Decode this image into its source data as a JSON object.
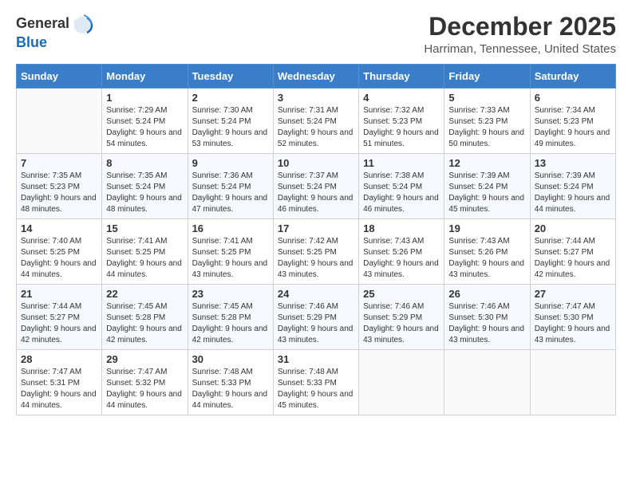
{
  "logo": {
    "general": "General",
    "blue": "Blue"
  },
  "title": "December 2025",
  "location": "Harriman, Tennessee, United States",
  "days_of_week": [
    "Sunday",
    "Monday",
    "Tuesday",
    "Wednesday",
    "Thursday",
    "Friday",
    "Saturday"
  ],
  "weeks": [
    [
      {
        "day": "",
        "sunrise": "",
        "sunset": "",
        "daylight": ""
      },
      {
        "day": "1",
        "sunrise": "Sunrise: 7:29 AM",
        "sunset": "Sunset: 5:24 PM",
        "daylight": "Daylight: 9 hours and 54 minutes."
      },
      {
        "day": "2",
        "sunrise": "Sunrise: 7:30 AM",
        "sunset": "Sunset: 5:24 PM",
        "daylight": "Daylight: 9 hours and 53 minutes."
      },
      {
        "day": "3",
        "sunrise": "Sunrise: 7:31 AM",
        "sunset": "Sunset: 5:24 PM",
        "daylight": "Daylight: 9 hours and 52 minutes."
      },
      {
        "day": "4",
        "sunrise": "Sunrise: 7:32 AM",
        "sunset": "Sunset: 5:23 PM",
        "daylight": "Daylight: 9 hours and 51 minutes."
      },
      {
        "day": "5",
        "sunrise": "Sunrise: 7:33 AM",
        "sunset": "Sunset: 5:23 PM",
        "daylight": "Daylight: 9 hours and 50 minutes."
      },
      {
        "day": "6",
        "sunrise": "Sunrise: 7:34 AM",
        "sunset": "Sunset: 5:23 PM",
        "daylight": "Daylight: 9 hours and 49 minutes."
      }
    ],
    [
      {
        "day": "7",
        "sunrise": "Sunrise: 7:35 AM",
        "sunset": "Sunset: 5:23 PM",
        "daylight": "Daylight: 9 hours and 48 minutes."
      },
      {
        "day": "8",
        "sunrise": "Sunrise: 7:35 AM",
        "sunset": "Sunset: 5:24 PM",
        "daylight": "Daylight: 9 hours and 48 minutes."
      },
      {
        "day": "9",
        "sunrise": "Sunrise: 7:36 AM",
        "sunset": "Sunset: 5:24 PM",
        "daylight": "Daylight: 9 hours and 47 minutes."
      },
      {
        "day": "10",
        "sunrise": "Sunrise: 7:37 AM",
        "sunset": "Sunset: 5:24 PM",
        "daylight": "Daylight: 9 hours and 46 minutes."
      },
      {
        "day": "11",
        "sunrise": "Sunrise: 7:38 AM",
        "sunset": "Sunset: 5:24 PM",
        "daylight": "Daylight: 9 hours and 46 minutes."
      },
      {
        "day": "12",
        "sunrise": "Sunrise: 7:39 AM",
        "sunset": "Sunset: 5:24 PM",
        "daylight": "Daylight: 9 hours and 45 minutes."
      },
      {
        "day": "13",
        "sunrise": "Sunrise: 7:39 AM",
        "sunset": "Sunset: 5:24 PM",
        "daylight": "Daylight: 9 hours and 44 minutes."
      }
    ],
    [
      {
        "day": "14",
        "sunrise": "Sunrise: 7:40 AM",
        "sunset": "Sunset: 5:25 PM",
        "daylight": "Daylight: 9 hours and 44 minutes."
      },
      {
        "day": "15",
        "sunrise": "Sunrise: 7:41 AM",
        "sunset": "Sunset: 5:25 PM",
        "daylight": "Daylight: 9 hours and 44 minutes."
      },
      {
        "day": "16",
        "sunrise": "Sunrise: 7:41 AM",
        "sunset": "Sunset: 5:25 PM",
        "daylight": "Daylight: 9 hours and 43 minutes."
      },
      {
        "day": "17",
        "sunrise": "Sunrise: 7:42 AM",
        "sunset": "Sunset: 5:25 PM",
        "daylight": "Daylight: 9 hours and 43 minutes."
      },
      {
        "day": "18",
        "sunrise": "Sunrise: 7:43 AM",
        "sunset": "Sunset: 5:26 PM",
        "daylight": "Daylight: 9 hours and 43 minutes."
      },
      {
        "day": "19",
        "sunrise": "Sunrise: 7:43 AM",
        "sunset": "Sunset: 5:26 PM",
        "daylight": "Daylight: 9 hours and 43 minutes."
      },
      {
        "day": "20",
        "sunrise": "Sunrise: 7:44 AM",
        "sunset": "Sunset: 5:27 PM",
        "daylight": "Daylight: 9 hours and 42 minutes."
      }
    ],
    [
      {
        "day": "21",
        "sunrise": "Sunrise: 7:44 AM",
        "sunset": "Sunset: 5:27 PM",
        "daylight": "Daylight: 9 hours and 42 minutes."
      },
      {
        "day": "22",
        "sunrise": "Sunrise: 7:45 AM",
        "sunset": "Sunset: 5:28 PM",
        "daylight": "Daylight: 9 hours and 42 minutes."
      },
      {
        "day": "23",
        "sunrise": "Sunrise: 7:45 AM",
        "sunset": "Sunset: 5:28 PM",
        "daylight": "Daylight: 9 hours and 42 minutes."
      },
      {
        "day": "24",
        "sunrise": "Sunrise: 7:46 AM",
        "sunset": "Sunset: 5:29 PM",
        "daylight": "Daylight: 9 hours and 43 minutes."
      },
      {
        "day": "25",
        "sunrise": "Sunrise: 7:46 AM",
        "sunset": "Sunset: 5:29 PM",
        "daylight": "Daylight: 9 hours and 43 minutes."
      },
      {
        "day": "26",
        "sunrise": "Sunrise: 7:46 AM",
        "sunset": "Sunset: 5:30 PM",
        "daylight": "Daylight: 9 hours and 43 minutes."
      },
      {
        "day": "27",
        "sunrise": "Sunrise: 7:47 AM",
        "sunset": "Sunset: 5:30 PM",
        "daylight": "Daylight: 9 hours and 43 minutes."
      }
    ],
    [
      {
        "day": "28",
        "sunrise": "Sunrise: 7:47 AM",
        "sunset": "Sunset: 5:31 PM",
        "daylight": "Daylight: 9 hours and 44 minutes."
      },
      {
        "day": "29",
        "sunrise": "Sunrise: 7:47 AM",
        "sunset": "Sunset: 5:32 PM",
        "daylight": "Daylight: 9 hours and 44 minutes."
      },
      {
        "day": "30",
        "sunrise": "Sunrise: 7:48 AM",
        "sunset": "Sunset: 5:33 PM",
        "daylight": "Daylight: 9 hours and 44 minutes."
      },
      {
        "day": "31",
        "sunrise": "Sunrise: 7:48 AM",
        "sunset": "Sunset: 5:33 PM",
        "daylight": "Daylight: 9 hours and 45 minutes."
      },
      {
        "day": "",
        "sunrise": "",
        "sunset": "",
        "daylight": ""
      },
      {
        "day": "",
        "sunrise": "",
        "sunset": "",
        "daylight": ""
      },
      {
        "day": "",
        "sunrise": "",
        "sunset": "",
        "daylight": ""
      }
    ]
  ]
}
